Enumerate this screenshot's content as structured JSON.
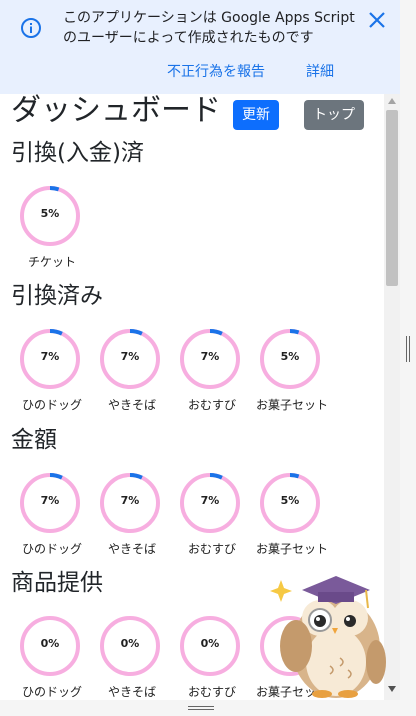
{
  "banner": {
    "message": "このアプリケーションは Google Apps Script のユーザーによって作成されたものです",
    "report_link": "不正行為を報告",
    "detail_link": "詳細"
  },
  "header": {
    "title": "ダッシュボード",
    "refresh_label": "更新",
    "top_label": "トップ"
  },
  "sections": [
    {
      "title": "引換(入金)済",
      "items": [
        {
          "label": "チケット",
          "percent": "5%",
          "value": 5
        }
      ]
    },
    {
      "title": "引換済み",
      "items": [
        {
          "label": "ひのドッグ",
          "percent": "7%",
          "value": 7
        },
        {
          "label": "やきそば",
          "percent": "7%",
          "value": 7
        },
        {
          "label": "おむすび",
          "percent": "7%",
          "value": 7
        },
        {
          "label": "お菓子セット",
          "percent": "5%",
          "value": 5
        }
      ]
    },
    {
      "title": "金額",
      "items": [
        {
          "label": "ひのドッグ",
          "percent": "7%",
          "value": 7
        },
        {
          "label": "やきそば",
          "percent": "7%",
          "value": 7
        },
        {
          "label": "おむすび",
          "percent": "7%",
          "value": 7
        },
        {
          "label": "お菓子セット",
          "percent": "5%",
          "value": 5
        }
      ]
    },
    {
      "title": "商品提供",
      "items": [
        {
          "label": "ひのドッグ",
          "percent": "0%",
          "value": 0
        },
        {
          "label": "やきそば",
          "percent": "0%",
          "value": 0
        },
        {
          "label": "おむすび",
          "percent": "0%",
          "value": 0
        },
        {
          "label": "お菓子セット",
          "percent": "0%",
          "value": 0
        }
      ]
    }
  ],
  "colors": {
    "ring_track": "#f7aee0",
    "ring_progress": "#1a73e8",
    "banner_bg": "#e8f0fe",
    "link": "#1a73e8",
    "refresh_button": "#0d6efd",
    "top_button": "#6c757d"
  },
  "icons": {
    "info": "info-icon",
    "close": "close-icon",
    "mascot": "owl-mascot"
  }
}
